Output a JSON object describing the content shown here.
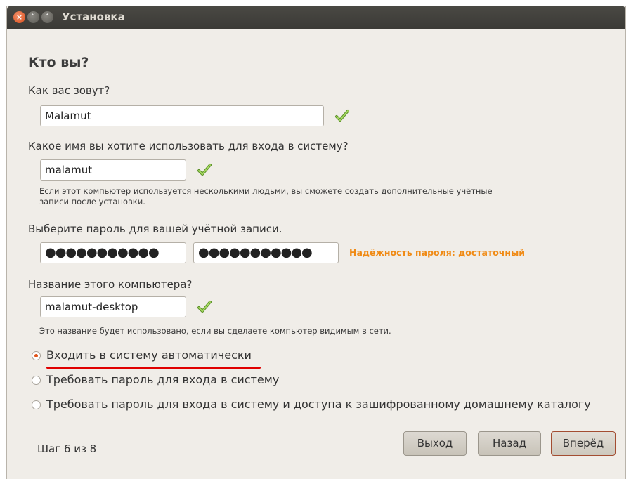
{
  "window": {
    "title": "Установка"
  },
  "heading": "Кто вы?",
  "name": {
    "label": "Как вас зовут?",
    "value": "Malamut"
  },
  "login": {
    "label": "Какое имя вы хотите использовать для входа в систему?",
    "value": "malamut",
    "hint_line1": "Если этот компьютер используется несколькими людьми, вы сможете создать дополнительные учётные",
    "hint_line2": "записи после установки."
  },
  "password": {
    "label": "Выберите пароль для вашей учётной записи.",
    "value": "●●●●●●●●●●●",
    "confirm_value": "●●●●●●●●●●●",
    "strength": "Надёжность пароля: достаточный"
  },
  "hostname": {
    "label": "Название этого компьютера?",
    "value": "malamut-desktop",
    "hint": "Это название будет использовано, если вы сделаете компьютер видимым в сети."
  },
  "login_options": [
    {
      "label": "Входить в систему автоматически",
      "selected": true
    },
    {
      "label": "Требовать пароль для входа в систему",
      "selected": false
    },
    {
      "label": "Требовать пароль для входа в систему и доступа к зашифрованному домашнему каталогу",
      "selected": false
    }
  ],
  "footer": {
    "step": "Шаг 6 из 8",
    "quit_label": "Выход",
    "back_label": "Назад",
    "forward_label": "Вперёд"
  },
  "colors": {
    "accent": "#e0541a",
    "strength": "#f08a14",
    "check": "#7db83a",
    "annotation": "#e00000"
  },
  "icons": {
    "check": "checkmark-icon",
    "close": "close-icon",
    "minimize": "minimize-icon",
    "maximize": "maximize-icon"
  }
}
